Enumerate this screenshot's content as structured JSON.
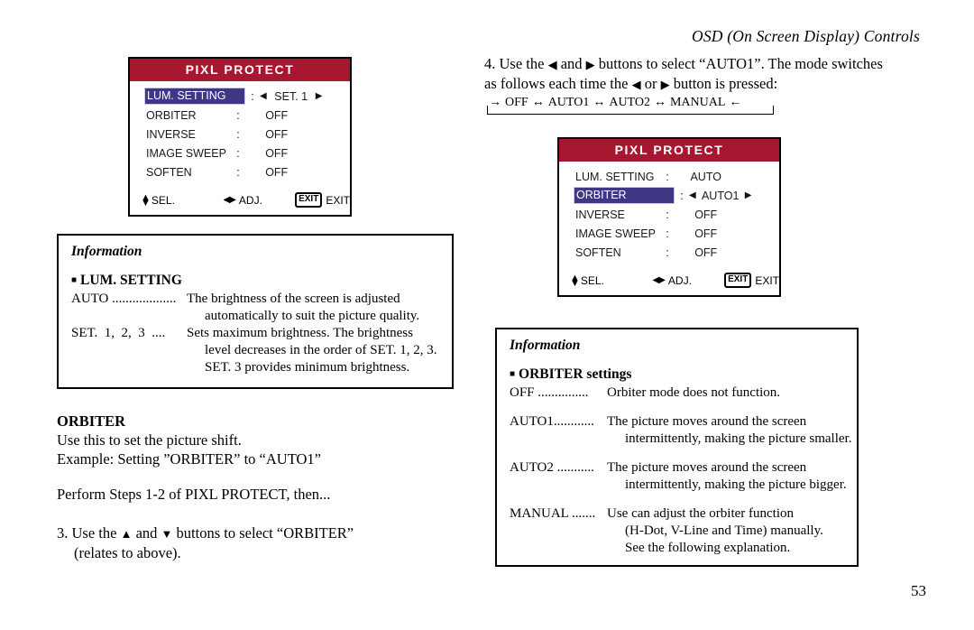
{
  "running_head": "OSD (On Screen Display) Controls",
  "page_number": "53",
  "osd1": {
    "title": "PIXL PROTECT",
    "rows": [
      {
        "label": "LUM. SETTING",
        "colon": ":",
        "value": "SET. 1",
        "selected": true,
        "arrows": true
      },
      {
        "label": "ORBITER",
        "colon": ":",
        "value": "OFF",
        "selected": false,
        "arrows": false
      },
      {
        "label": "INVERSE",
        "colon": ":",
        "value": "OFF",
        "selected": false,
        "arrows": false
      },
      {
        "label": "IMAGE SWEEP",
        "colon": ":",
        "value": "OFF",
        "selected": false,
        "arrows": false
      },
      {
        "label": "SOFTEN",
        "colon": ":",
        "value": "OFF",
        "selected": false,
        "arrows": false
      }
    ],
    "footer": {
      "sel": "SEL.",
      "adj": "ADJ.",
      "exit_key": "EXIT",
      "exit_label": "EXIT"
    }
  },
  "osd2": {
    "title": "PIXL PROTECT",
    "rows": [
      {
        "label": "LUM. SETTING",
        "colon": ":",
        "value": "AUTO",
        "selected": false,
        "arrows": false
      },
      {
        "label": "ORBITER",
        "colon": ":",
        "value": "AUTO1",
        "selected": true,
        "arrows": true
      },
      {
        "label": "INVERSE",
        "colon": ":",
        "value": "OFF",
        "selected": false,
        "arrows": false
      },
      {
        "label": "IMAGE SWEEP",
        "colon": ":",
        "value": "OFF",
        "selected": false,
        "arrows": false
      },
      {
        "label": "SOFTEN",
        "colon": ":",
        "value": "OFF",
        "selected": false,
        "arrows": false
      }
    ],
    "footer": {
      "sel": "SEL.",
      "adj": "ADJ.",
      "exit_key": "EXIT",
      "exit_label": "EXIT"
    }
  },
  "info_left": {
    "title": "Information",
    "heading": "LUM. SETTING",
    "entries": [
      {
        "term": "AUTO ...................",
        "lines": [
          "The brightness of the screen is adjusted",
          "automatically to suit the picture quality."
        ]
      },
      {
        "term": "SET.  1,  2,  3  ....",
        "lines": [
          "Sets  maximum  brightness.  The  brightness",
          "level decreases in the order of SET. 1, 2, 3.",
          "SET. 3 provides minimum brightness."
        ]
      }
    ]
  },
  "info_right": {
    "title": "Information",
    "heading": "ORBITER settings",
    "entries": [
      {
        "term": "OFF ...............",
        "lines": [
          "Orbiter mode does not function."
        ]
      },
      {
        "term": "AUTO1............",
        "lines": [
          "The picture moves around the screen",
          "intermittently, making the picture smaller."
        ]
      },
      {
        "term": "AUTO2 ...........",
        "lines": [
          "The picture moves around the screen",
          "intermittently, making the picture bigger."
        ]
      },
      {
        "term": "MANUAL .......",
        "lines": [
          "Use can adjust the orbiter function",
          "(H-Dot, V-Line and Time) manually.",
          "See the following explanation."
        ]
      }
    ]
  },
  "step4": {
    "line1_a": "4. Use the ",
    "line1_b": " and ",
    "line1_c": " buttons to select “AUTO1”. The mode switches",
    "line2_a": "as follows each time the ",
    "line2_b": " or ",
    "line2_c": " button is pressed:"
  },
  "cycle": {
    "in_arrow": "→",
    "items": [
      "OFF",
      "AUTO1",
      "AUTO2",
      "MANUAL"
    ],
    "sep": "↔",
    "out_arrow": "←"
  },
  "orbiter_section": {
    "heading": "ORBITER",
    "line1": "Use this to set the picture shift.",
    "line2": "Example: Setting ”ORBITER” to “AUTO1”",
    "line3": "Perform Steps 1-2 of PIXL PROTECT, then...",
    "step3_a": "3. Use the ",
    "step3_b": " and ",
    "step3_c": " buttons to select “ORBITER”",
    "step3_d": "(relates to above)."
  },
  "glyphs": {
    "left": "◀",
    "right": "▶",
    "up": "▲",
    "down": "▼",
    "square": "■"
  },
  "colors": {
    "osd_header_red": "#a81730",
    "osd_highlight_blue": "#3e3785",
    "page_bg": "#ffffff"
  }
}
